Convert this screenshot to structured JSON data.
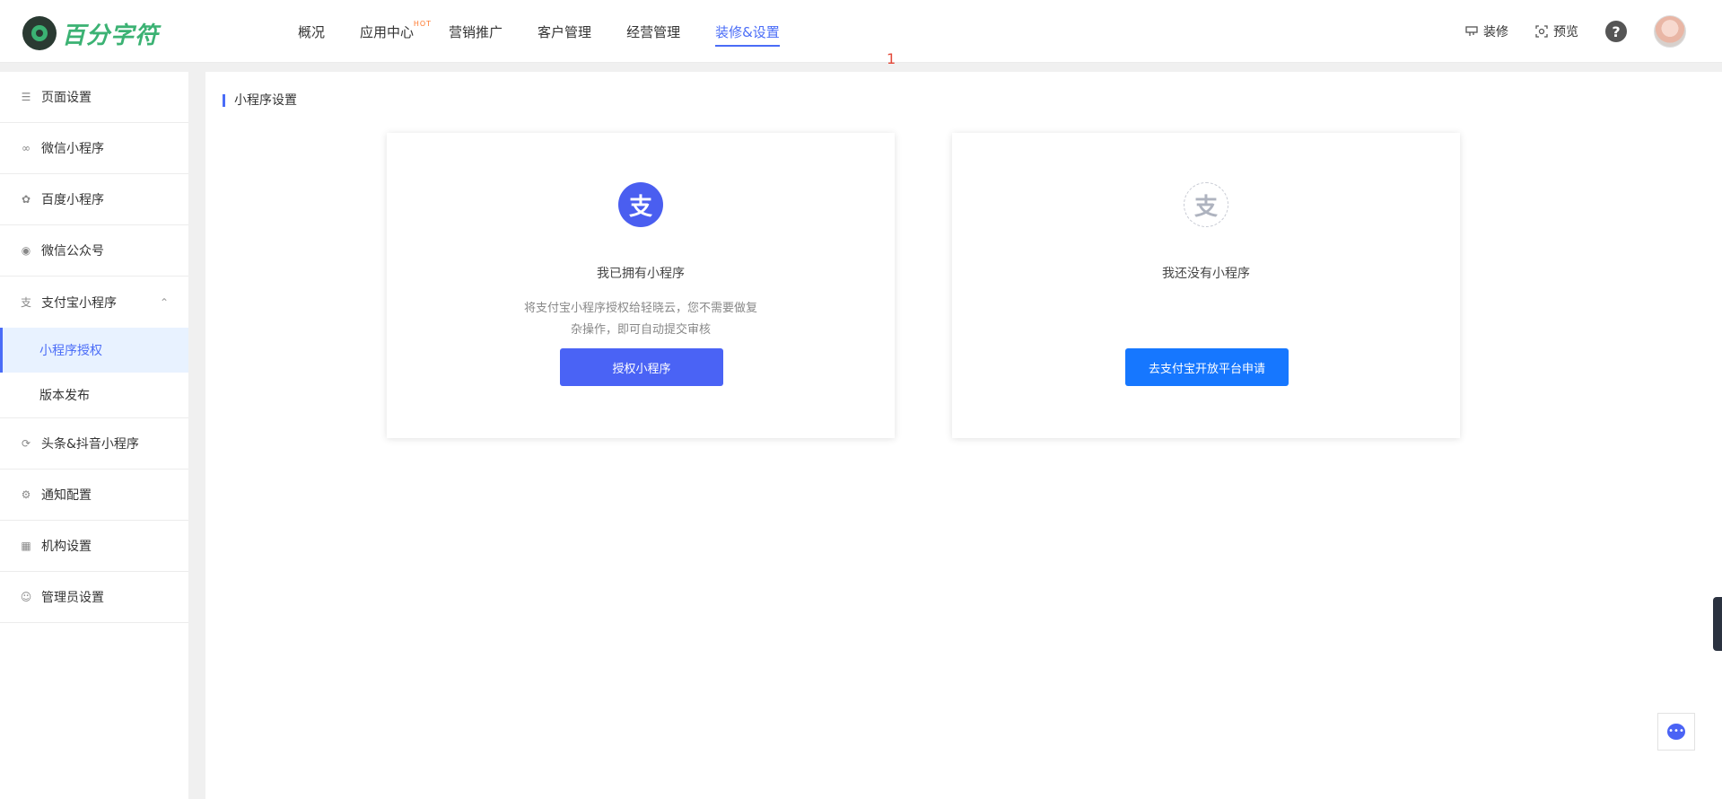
{
  "brand": {
    "name": "百分字符"
  },
  "nav": {
    "items": [
      {
        "label": "概况"
      },
      {
        "label": "应用中心",
        "badge": "HOT"
      },
      {
        "label": "营销推广"
      },
      {
        "label": "客户管理"
      },
      {
        "label": "经营管理"
      },
      {
        "label": "装修&设置",
        "active": true
      }
    ]
  },
  "header_right": {
    "decorate_label": "装修",
    "preview_label": "预览",
    "help_label": "?"
  },
  "marker": "1",
  "sidebar": {
    "items": [
      {
        "label": "页面设置",
        "icon": "layers-icon"
      },
      {
        "label": "微信小程序",
        "icon": "mini-program-icon"
      },
      {
        "label": "百度小程序",
        "icon": "paw-icon"
      },
      {
        "label": "微信公众号",
        "icon": "wechat-icon"
      },
      {
        "label": "支付宝小程序",
        "icon": "alipay-icon",
        "expanded": true,
        "children": [
          {
            "label": "小程序授权",
            "active": true
          },
          {
            "label": "版本发布"
          }
        ]
      },
      {
        "label": "头条&抖音小程序",
        "icon": "toutiao-icon"
      },
      {
        "label": "通知配置",
        "icon": "gear-icon"
      },
      {
        "label": "机构设置",
        "icon": "building-icon"
      },
      {
        "label": "管理员设置",
        "icon": "user-gear-icon"
      }
    ]
  },
  "main": {
    "section_title": "小程序设置",
    "cards": [
      {
        "icon_glyph": "支",
        "title": "我已拥有小程序",
        "desc_line1": "将支付宝小程序授权给轻晓云，您不需要做复",
        "desc_line2": "杂操作，即可自动提交审核",
        "button": "授权小程序"
      },
      {
        "icon_glyph": "支",
        "title": "我还没有小程序",
        "button": "去支付宝开放平台申请"
      }
    ]
  },
  "colors": {
    "accent": "#4a6cf7",
    "brand_green": "#3bb273",
    "alipay_blue": "#1677ff"
  }
}
